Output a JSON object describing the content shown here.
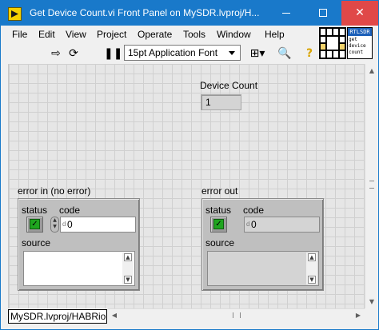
{
  "window": {
    "title": "Get Device Count.vi Front Panel on MySDR.lvproj/H...",
    "minimize": "–",
    "maximize": "□",
    "close": "✕"
  },
  "menu": {
    "items": [
      "File",
      "Edit",
      "View",
      "Project",
      "Operate",
      "Tools",
      "Window",
      "Help"
    ]
  },
  "toolbar": {
    "run_icon": "run-arrow-icon",
    "run_continuous_icon": "run-continuously-icon",
    "pause_icon": "pause-icon",
    "font_select": "15pt Application Font",
    "align_icon": "align-objects-icon",
    "search_icon": "search-icon",
    "help_icon": "context-help-icon"
  },
  "vi_icon": {
    "header": "RTLSDR",
    "body": "get\ndevice\ncount"
  },
  "controls": {
    "device_count": {
      "label": "Device Count",
      "value": "1"
    },
    "error_in": {
      "label": "error in (no error)",
      "status_label": "status",
      "status_check": "✓",
      "code_label": "code",
      "code_value": "0",
      "code_radix": "d",
      "source_label": "source",
      "source_value": ""
    },
    "error_out": {
      "label": "error out",
      "status_label": "status",
      "status_check": "✓",
      "code_label": "code",
      "code_value": "0",
      "code_radix": "d",
      "source_label": "source",
      "source_value": ""
    }
  },
  "statusbar": {
    "context": "MySDR.lvproj/HABRio"
  },
  "colors": {
    "titlebar": "#1979ca",
    "close_button": "#e04848",
    "status_led_on": "#1fa51f"
  }
}
